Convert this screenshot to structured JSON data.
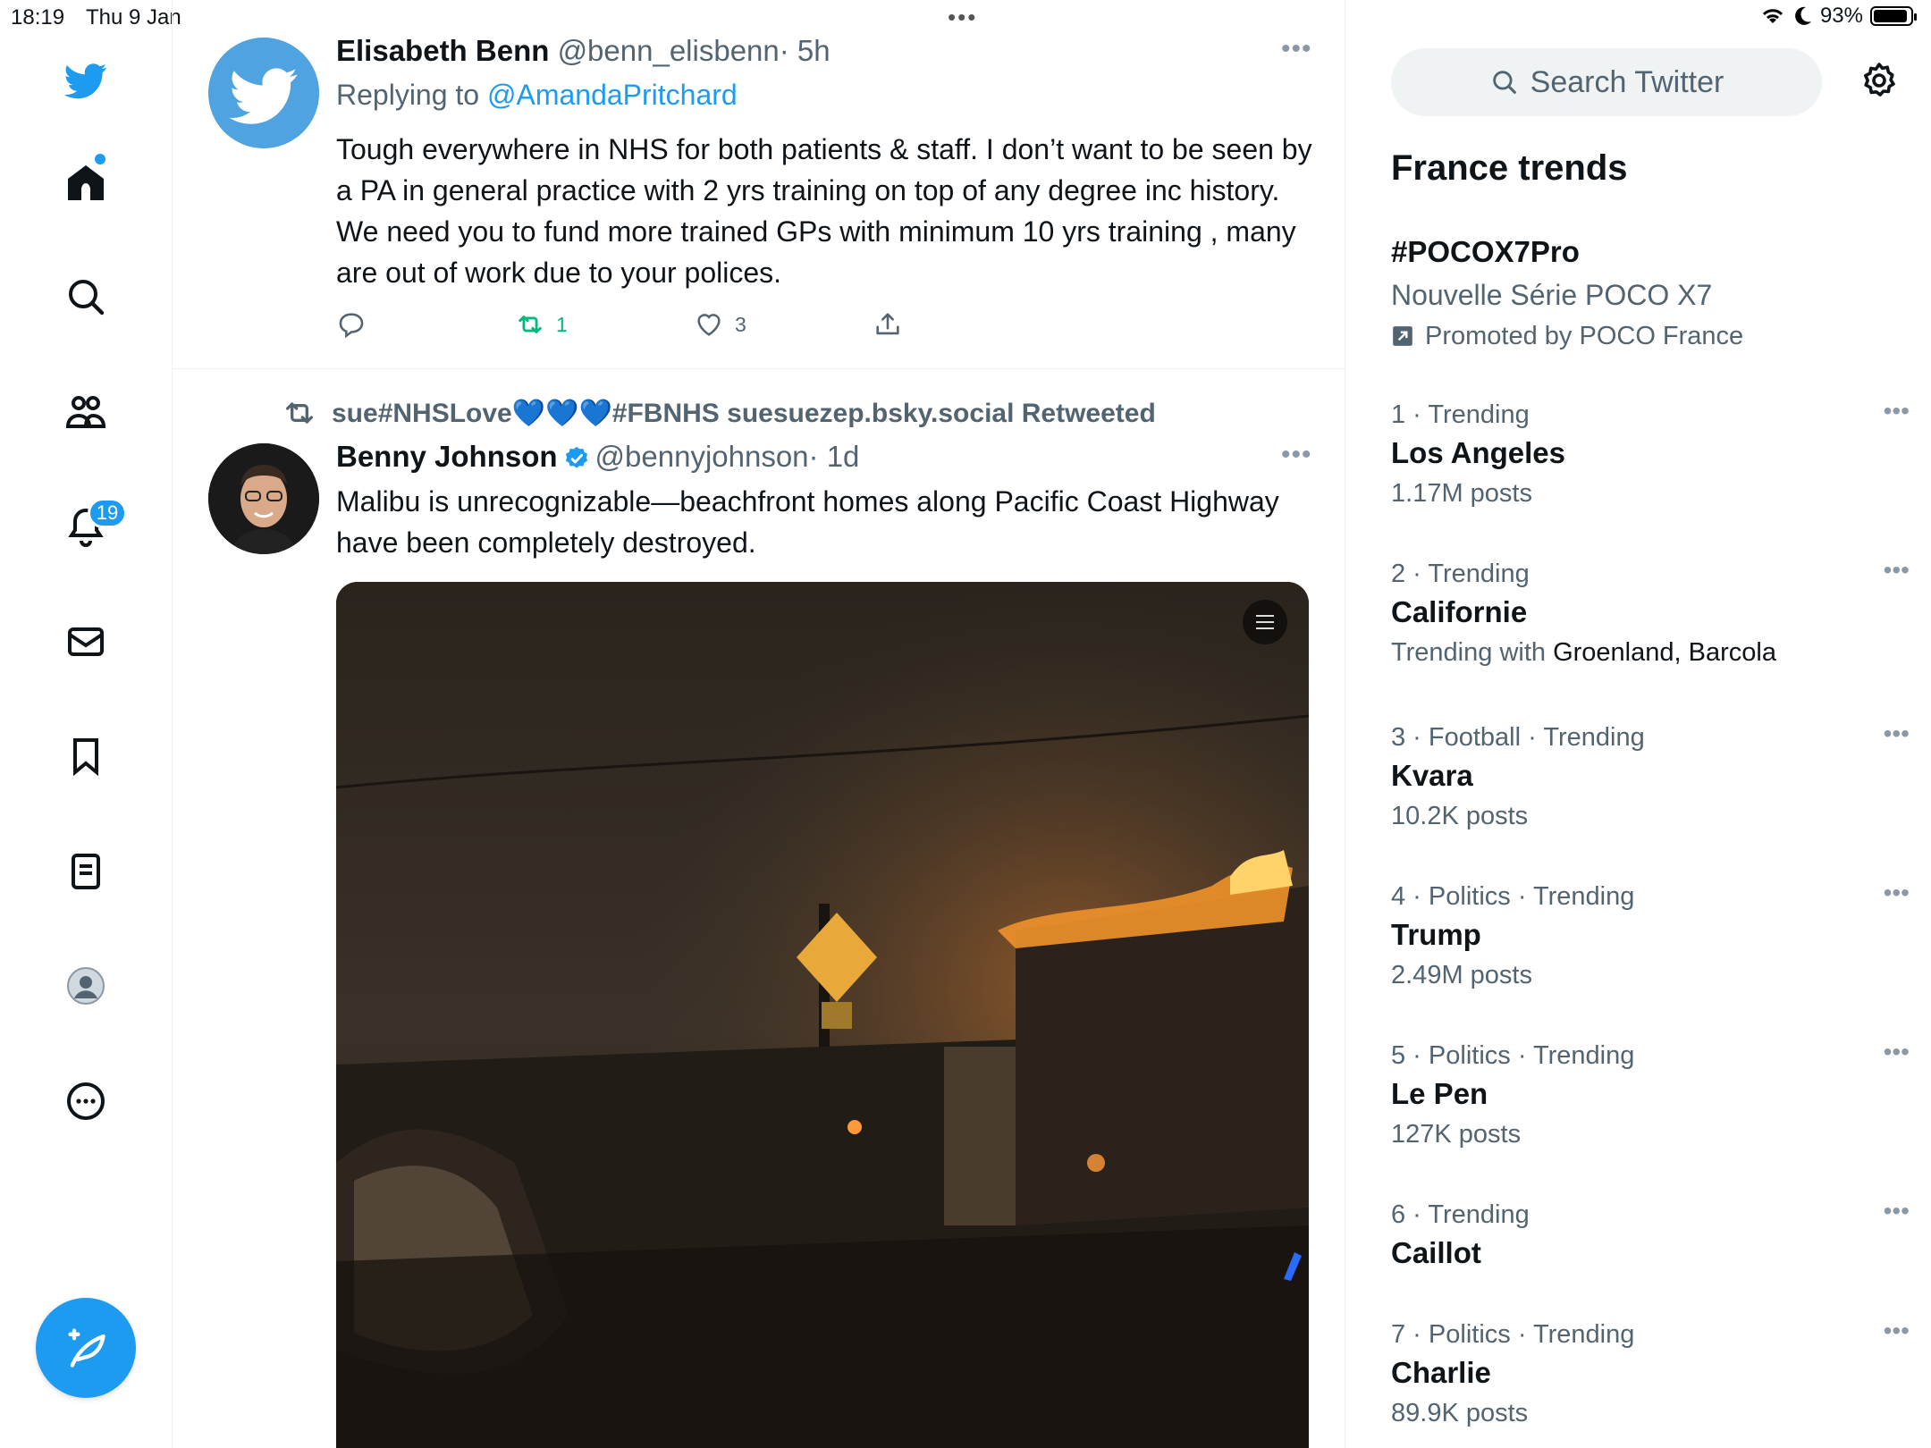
{
  "status_bar": {
    "time": "18:19",
    "date": "Thu 9 Jan",
    "center_dots": "•••",
    "battery_percent": "93%",
    "battery_level": 0.93
  },
  "nav": {
    "icons": [
      "twitter-bird-icon",
      "home-icon",
      "search-icon",
      "communities-icon",
      "notifications-icon",
      "messages-icon",
      "bookmarks-icon",
      "lists-icon",
      "profile-icon",
      "more-icon"
    ],
    "notifications_badge": "19",
    "compose_icon": "compose-icon"
  },
  "tweet1": {
    "name": "Elisabeth Benn",
    "handle": "@benn_elisbenn",
    "time": "· 5h",
    "replying_prefix": "Replying to",
    "replying_to": "@AmandaPritchard",
    "text": "Tough everywhere in NHS for both patients & staff. I don’t want to be seen by a PA in general practice with 2 yrs training on top of any degree inc history.  We need you to fund more trained GPs with minimum 10 yrs training , many are out of  work due to your polices.",
    "retweets": "1",
    "likes": "3",
    "more": "•••"
  },
  "tweet2": {
    "retweeted_by": "sue#NHSLove💙💙💙#FBNHS suesuezep.bsky.social Retweeted",
    "name": "Benny Johnson",
    "handle": "@bennyjohnson",
    "time": "· 1d",
    "text": "Malibu is unrecognizable—beachfront homes along Pacific Coast Highway have been completely destroyed.",
    "more": "•••"
  },
  "sidebar": {
    "search_placeholder": "Search Twitter",
    "trends_title": "France trends",
    "promoted": {
      "name": "#POCOX7Pro",
      "description": "Nouvelle Série POCO X7",
      "promoted_by": "Promoted by POCO France"
    },
    "trends": [
      {
        "context": "1 · Trending",
        "name": "Los Angeles",
        "sub": "1.17M posts"
      },
      {
        "context": "2 · Trending",
        "name": "Californie",
        "sub_prefix": "Trending with ",
        "sub_with": "Groenland, Barcola"
      },
      {
        "context": "3 · Football · Trending",
        "name": "Kvara",
        "sub": "10.2K posts"
      },
      {
        "context": "4 · Politics · Trending",
        "name": "Trump",
        "sub": "2.49M posts"
      },
      {
        "context": "5 · Politics · Trending",
        "name": "Le Pen",
        "sub": "127K posts"
      },
      {
        "context": "6 · Trending",
        "name": "Caillot",
        "sub": ""
      },
      {
        "context": "7 · Politics · Trending",
        "name": "Charlie",
        "sub": "89.9K posts"
      }
    ],
    "more": "•••"
  },
  "colors": {
    "accent": "#1d9bf0",
    "retweet_green": "#00ba7c",
    "text": "#0f1419",
    "secondary": "#536471"
  }
}
